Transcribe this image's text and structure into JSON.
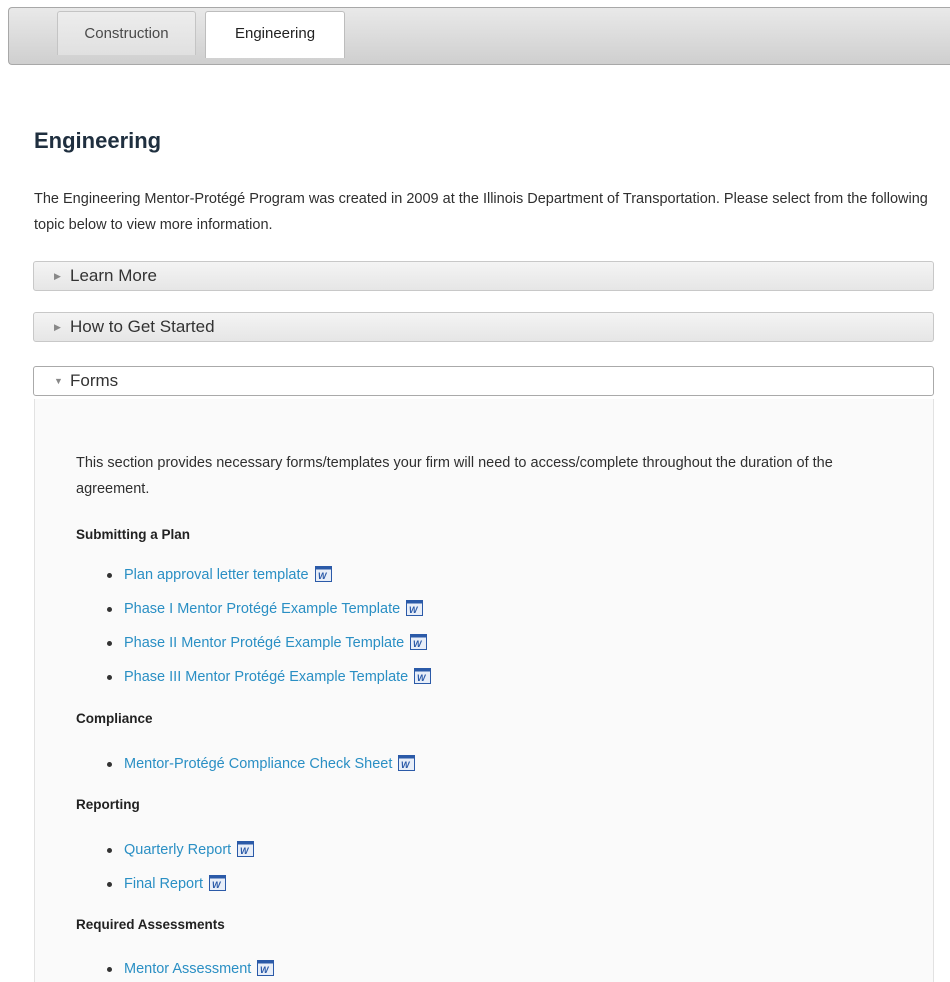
{
  "tabs": [
    {
      "label": "Construction",
      "active": false
    },
    {
      "label": "Engineering",
      "active": true
    }
  ],
  "page": {
    "title": "Engineering",
    "intro": "The Engineering Mentor-Protégé Program was created in 2009 at the Illinois Department of Transportation. Please select from the following topic below to view more information."
  },
  "accordion": [
    {
      "label": "Learn More",
      "expanded": false
    },
    {
      "label": "How to Get Started",
      "expanded": false
    },
    {
      "label": "Forms",
      "expanded": true
    }
  ],
  "forms": {
    "description": "This section provides necessary forms/templates your firm will need to access/complete throughout the duration of the agreement.",
    "sections": [
      {
        "heading": "Submitting a Plan",
        "links": [
          "Plan approval letter template",
          "Phase I Mentor Protégé Example Template",
          "Phase II Mentor Protégé Example Template",
          "Phase III Mentor Protégé Example Template"
        ]
      },
      {
        "heading": "Compliance",
        "links": [
          "Mentor-Protégé Compliance Check Sheet"
        ]
      },
      {
        "heading": "Reporting",
        "links": [
          "Quarterly Report",
          "Final Report"
        ]
      },
      {
        "heading": "Required Assessments",
        "links": [
          "Mentor Assessment"
        ]
      }
    ]
  },
  "icons": {
    "word_document": "word-document-icon",
    "collapsed_arrow": "caret-right-icon",
    "expanded_arrow": "caret-down-icon"
  },
  "colors": {
    "link": "#2a8fc4",
    "heading": "#1f2f3f",
    "word_icon": "#2b5aa8"
  }
}
